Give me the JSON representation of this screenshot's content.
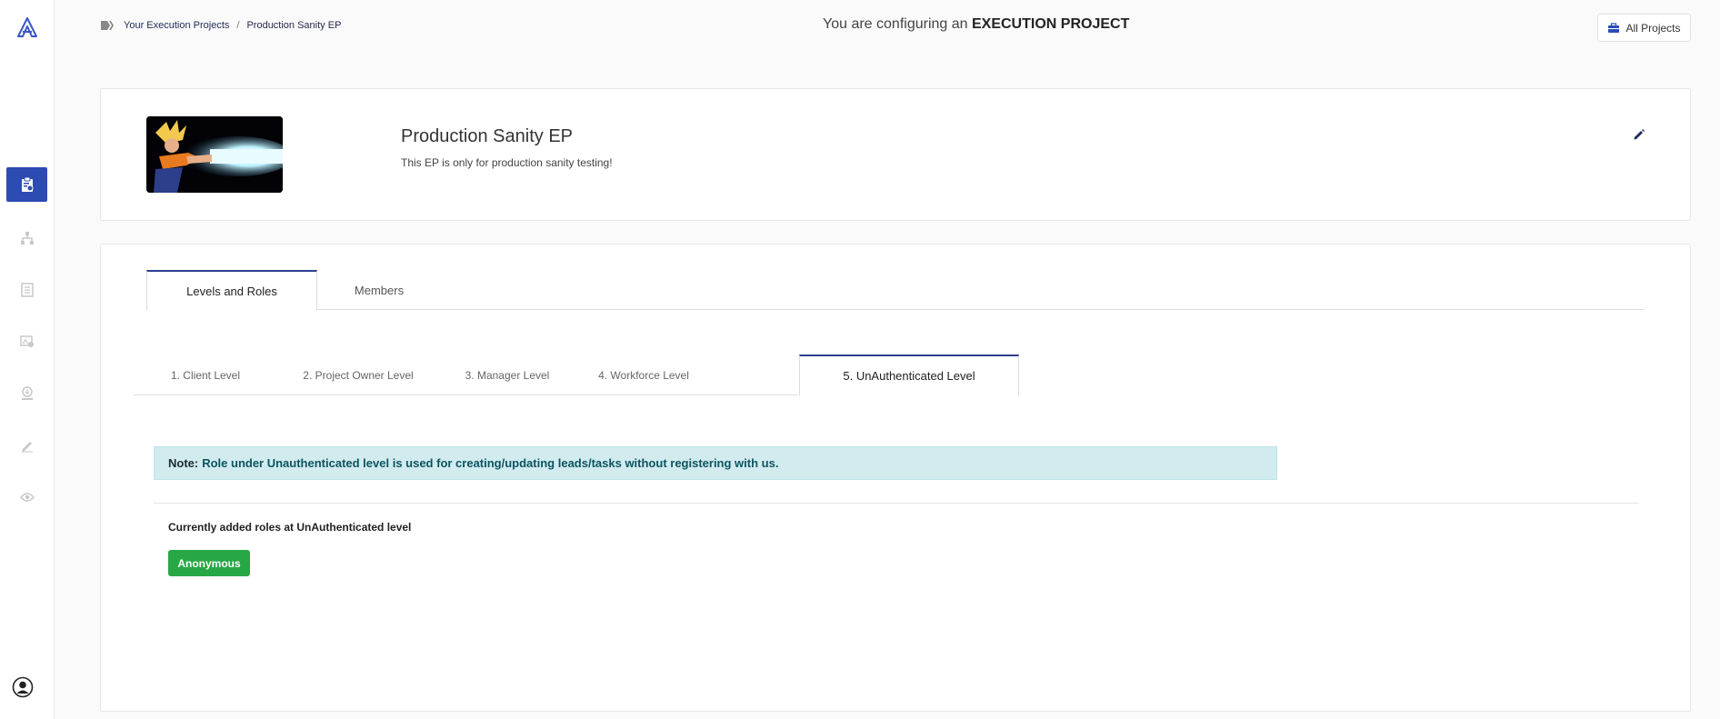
{
  "header": {
    "headline_prefix": "You are configuring an",
    "headline_emphasis": "EXECUTION PROJECT",
    "all_projects_label": "All Projects"
  },
  "breadcrumb": {
    "items": [
      {
        "label": "Your Execution Projects"
      },
      {
        "label": "Production Sanity EP"
      }
    ],
    "separator": "/"
  },
  "sidebar": {
    "items": [
      {
        "icon": "clipboard-icon",
        "active": true
      },
      {
        "icon": "hierarchy-icon",
        "active": false
      },
      {
        "icon": "document-icon",
        "active": false
      },
      {
        "icon": "image-settings-icon",
        "active": false
      },
      {
        "icon": "download-icon",
        "active": false
      },
      {
        "icon": "pen-icon",
        "active": false
      },
      {
        "icon": "eye-icon",
        "active": false
      }
    ]
  },
  "project": {
    "title": "Production Sanity EP",
    "description": "This EP is only for production sanity testing!"
  },
  "tabs": [
    {
      "label": "Levels and Roles",
      "active": true
    },
    {
      "label": "Members",
      "active": false
    }
  ],
  "levels": [
    {
      "label": "1. Client Level",
      "active": false
    },
    {
      "label": "2. Project Owner Level",
      "active": false
    },
    {
      "label": "3. Manager Level",
      "active": false
    },
    {
      "label": "4. Workforce Level",
      "active": false
    },
    {
      "label": "5. UnAuthenticated Level",
      "active": true
    }
  ],
  "note": {
    "label": "Note:",
    "text": "Role under Unauthenticated level is used for creating/updating leads/tasks without registering with us."
  },
  "roles": {
    "heading": "Currently added roles at UnAuthenticated level",
    "items": [
      "Anonymous"
    ]
  },
  "colors": {
    "accent": "#2c4bb3",
    "success": "#28a745",
    "note_bg": "#d1ebef"
  }
}
